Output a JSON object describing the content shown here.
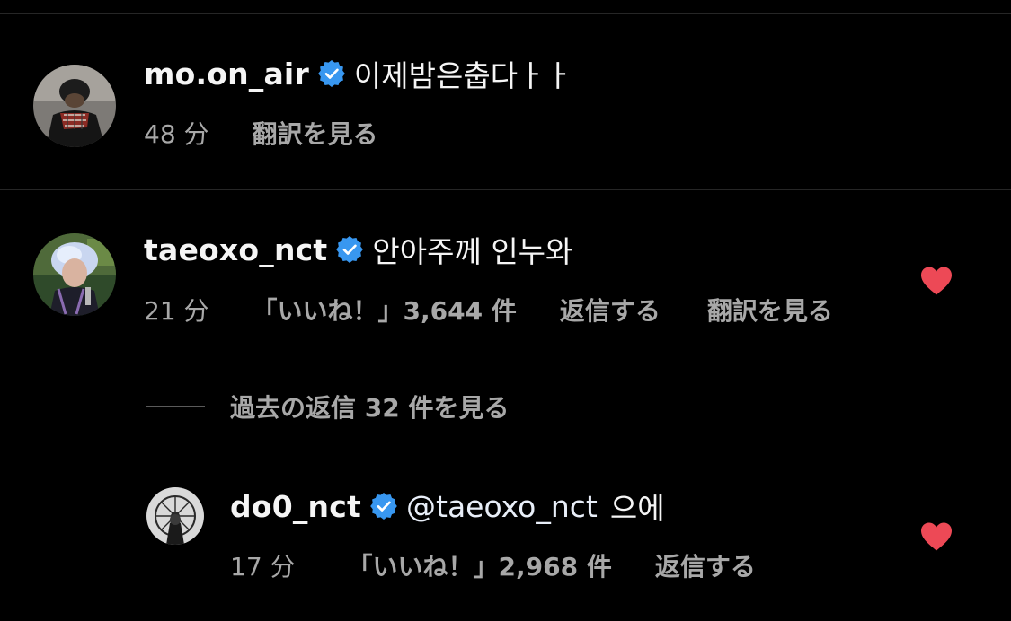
{
  "comments": [
    {
      "username": "mo.on_air",
      "text": "이제밤은춥다ㅏㅏ",
      "time": "48 分",
      "translate": "翻訳を見る"
    },
    {
      "username": "taeoxo_nct",
      "text": "안아주께 인누와",
      "time": "21 分",
      "likes": "「いいね！」3,644 件",
      "reply": "返信する",
      "translate": "翻訳を見る",
      "view_replies": "過去の返信 32 件を見る"
    }
  ],
  "reply": {
    "username": "do0_nct",
    "mention": "@taeoxo_nct",
    "text": "으에",
    "time": "17 分",
    "likes": "「いいね！」2,968 件",
    "reply": "返信する"
  },
  "icons": {
    "verified": "verified-badge-icon",
    "like": "heart-filled-icon"
  },
  "colors": {
    "background": "#000000",
    "verified_blue": "#3897f0",
    "heart_red": "#ed4956",
    "meta_gray": "#a8a8a8"
  }
}
